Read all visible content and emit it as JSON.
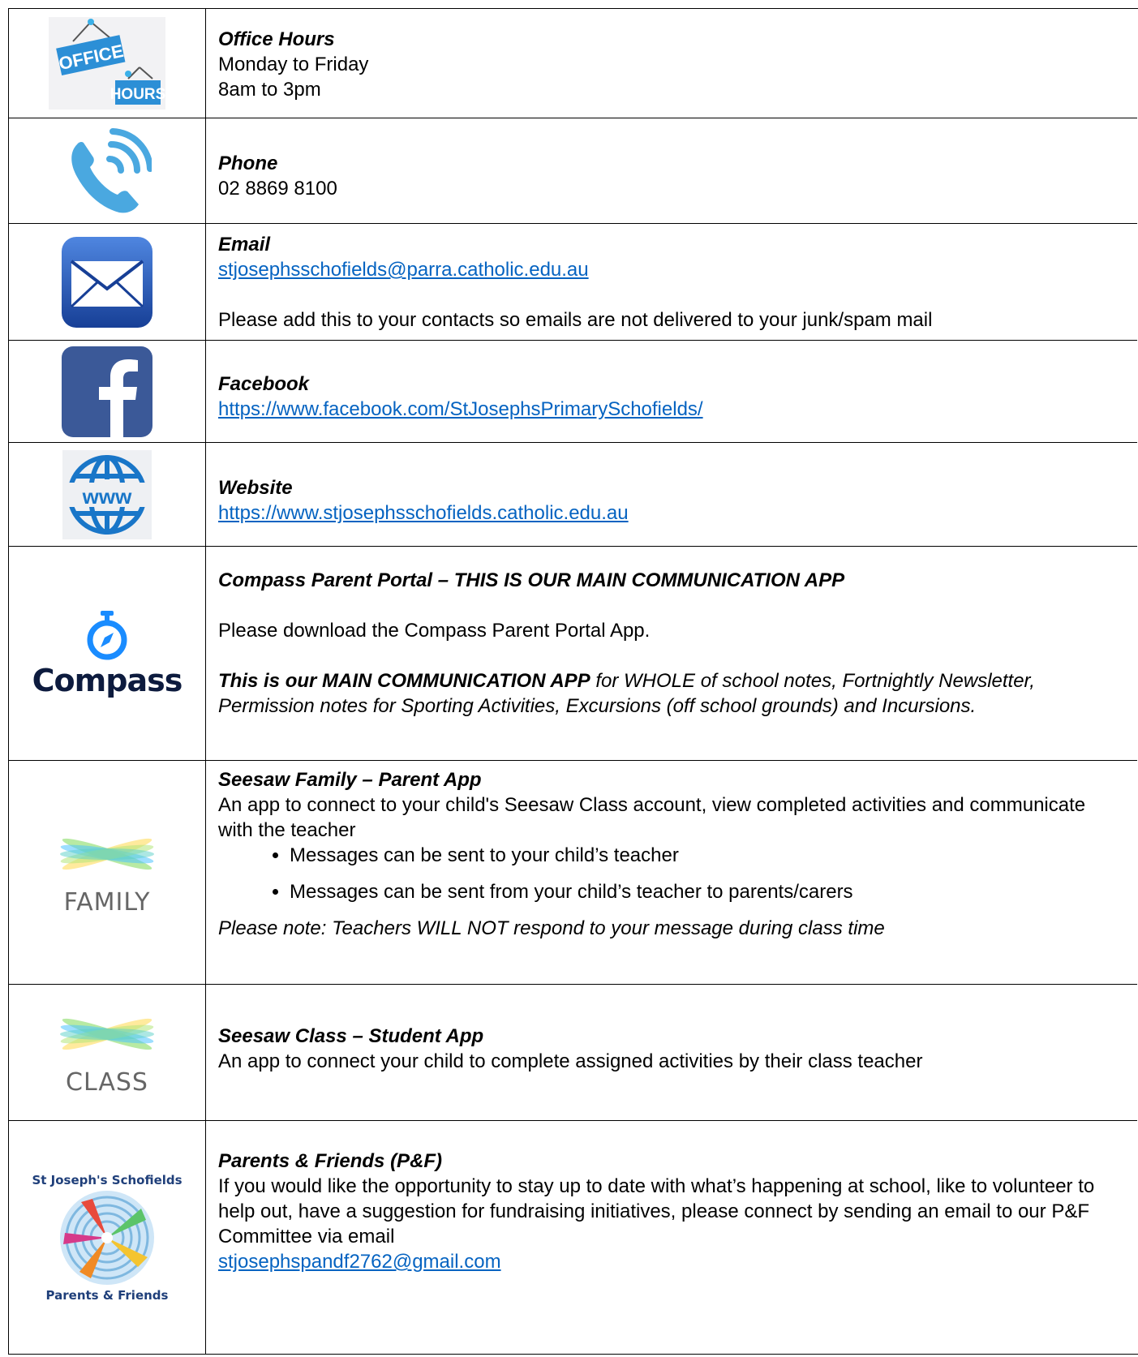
{
  "office": {
    "title": "Office Hours",
    "line1": "Monday to Friday",
    "line2": "8am to 3pm",
    "sign1": "OFFICE",
    "sign2": "HOURS"
  },
  "phone": {
    "title": "Phone",
    "number": "02 8869 8100"
  },
  "email": {
    "title": "Email",
    "address": "stjosephsschofields@parra.catholic.edu.au",
    "note": "Please add this to your contacts so emails are not delivered to your junk/spam mail"
  },
  "facebook": {
    "title": "Facebook",
    "url": "https://www.facebook.com/StJosephsPrimarySchofields/"
  },
  "website": {
    "title": "Website",
    "url": "https://www.stjosephsschofields.catholic.edu.au",
    "icon_text": "www"
  },
  "compass": {
    "title": "Compass Parent Portal – THIS IS OUR MAIN COMMUNICATION APP",
    "line1": "Please download the Compass Parent Portal App.",
    "bold_lead": "This is our MAIN COMMUNICATION APP",
    "rest": " for WHOLE of school notes, Fortnightly Newsletter, Permission notes for Sporting Activities, Excursions (off school grounds) and Incursions.",
    "logo_text": "Compass"
  },
  "seesaw_family": {
    "title": "Seesaw Family – Parent App",
    "desc": "An app to connect to your child's Seesaw Class account, view completed activities and communicate with the teacher",
    "bullets": [
      "Messages can be sent to your child’s teacher",
      "Messages can be sent from your child’s teacher to parents/carers"
    ],
    "note": "Please note: Teachers WILL NOT respond to your message during class time",
    "logo_text": "FAMILY"
  },
  "seesaw_class": {
    "title": "Seesaw Class – Student App",
    "desc": "An app to connect your child to complete assigned activities by their class teacher",
    "logo_text": "CLASS"
  },
  "pf": {
    "title": "Parents & Friends (P&F)",
    "desc": "If you would like the opportunity to stay up to date with what’s happening at school, like to volunteer to help out, have a suggestion for fundraising initiatives, please connect by sending an email to our P&F Committee via email",
    "email": "stjosephspandf2762@gmail.com",
    "logo_top": "St Joseph's Schofields",
    "logo_bottom": "Parents & Friends"
  },
  "colors": {
    "link": "#0563c1",
    "phone_blue": "#4aa8e0",
    "email_blue": "#1f4fa8",
    "facebook_blue": "#3b5998",
    "globe_blue": "#1976c8",
    "compass_navy": "#0d1b3e",
    "compass_blue": "#1a8cff"
  }
}
